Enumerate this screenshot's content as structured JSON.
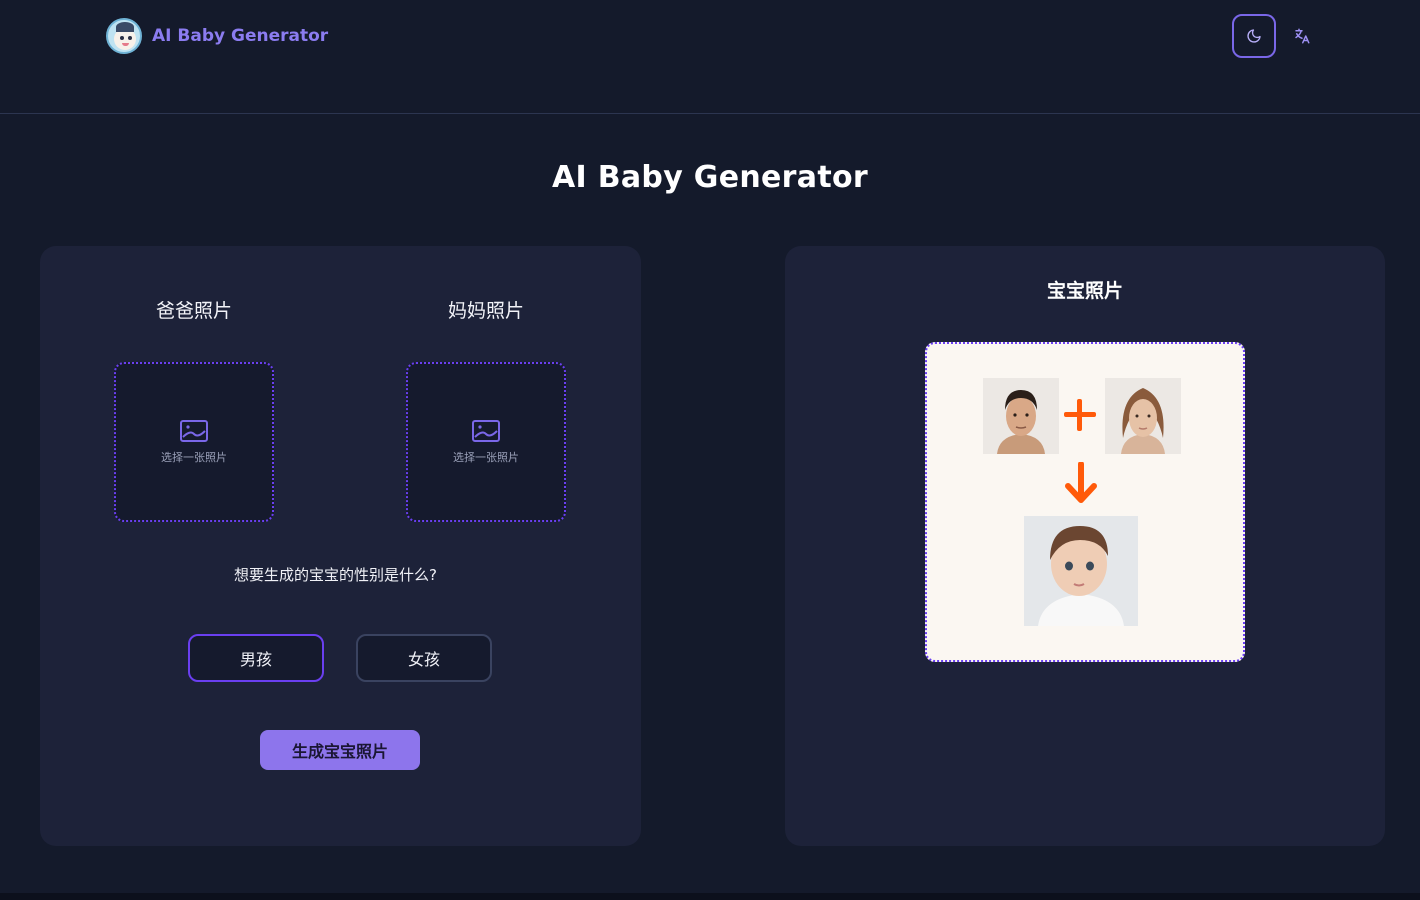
{
  "header": {
    "brand_name": "AI Baby Generator",
    "theme_toggle_icon": "moon-icon",
    "language_icon": "translate-icon"
  },
  "main": {
    "title": "AI Baby Generator"
  },
  "upload_panel": {
    "dad_label": "爸爸照片",
    "mom_label": "妈妈照片",
    "dad_upload_text": "选择一张照片",
    "mom_upload_text": "选择一张照片",
    "gender_question": "想要生成的宝宝的性别是什么?",
    "gender_options": [
      "男孩",
      "女孩"
    ],
    "selected_gender": "男孩",
    "generate_label": "生成宝宝照片"
  },
  "result_panel": {
    "title": "宝宝照片"
  },
  "colors": {
    "background": "#141a2b",
    "card": "#1d2239",
    "accent": "#6a3ff0",
    "button": "#8d75ec",
    "brand_text": "#8b7cf0",
    "result_symbols": "#ff5a0a"
  }
}
